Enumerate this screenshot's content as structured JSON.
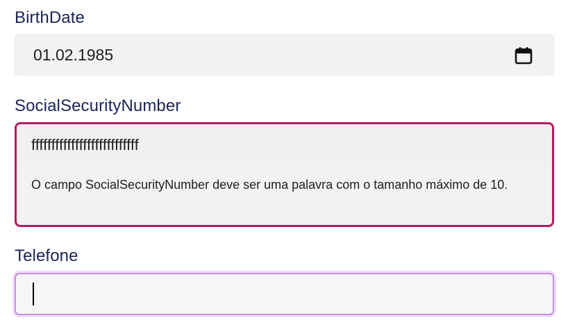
{
  "birthdate": {
    "label": "BirthDate",
    "value": "01.02.1985",
    "icon": "calendar-icon"
  },
  "ssn": {
    "label": "SocialSecurityNumber",
    "value": "fffffffffffffffffffffffffff",
    "error": "O campo SocialSecurityNumber deve ser uma palavra com o tamanho máximo de 10.",
    "error_color": "#b5195b"
  },
  "telefone": {
    "label": "Telefone",
    "value": "",
    "focus_color": "#c58ee0"
  }
}
